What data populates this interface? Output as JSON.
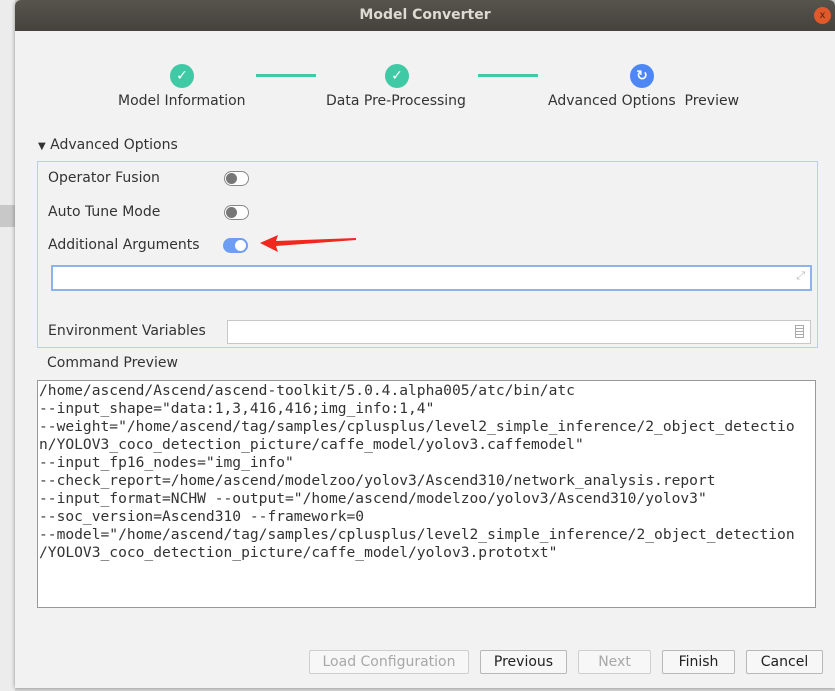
{
  "window": {
    "title": "Model Converter",
    "close_icon": "x"
  },
  "steps": [
    {
      "label": "Model Information",
      "state": "done",
      "icon": "✓"
    },
    {
      "label": "Data Pre-Processing",
      "state": "done",
      "icon": "✓"
    },
    {
      "label": "Advanced Options  Preview",
      "state": "current",
      "icon": "↻"
    }
  ],
  "colors": {
    "done": "#3fc9a4",
    "current": "#4d87f5",
    "arrow": "#f0281e"
  },
  "advanced": {
    "header": "Advanced Options",
    "arrow": "▼",
    "operator_fusion": {
      "label": "Operator Fusion",
      "on": false
    },
    "auto_tune": {
      "label": "Auto Tune Mode",
      "on": false
    },
    "additional_args": {
      "label": "Additional Arguments",
      "on": true,
      "value": ""
    },
    "env_vars": {
      "label": "Environment Variables",
      "value": ""
    }
  },
  "command_preview": {
    "label": "Command Preview",
    "lines": [
      "/home/ascend/Ascend/ascend-toolkit/5.0.4.alpha005/atc/bin/atc",
      "--input_shape=\"data:1,3,416,416;img_info:1,4\"",
      "--weight=\"/home/ascend/tag/samples/cplusplus/level2_simple_inference/2_object_detectio",
      "n/YOLOV3_coco_detection_picture/caffe_model/yolov3.caffemodel\"",
      "--input_fp16_nodes=\"img_info\"",
      "--check_report=/home/ascend/modelzoo/yolov3/Ascend310/network_analysis.report",
      "--input_format=NCHW --output=\"/home/ascend/modelzoo/yolov3/Ascend310/yolov3\"",
      "--soc_version=Ascend310 --framework=0",
      "--model=\"/home/ascend/tag/samples/cplusplus/level2_simple_inference/2_object_detection",
      "/YOLOV3_coco_detection_picture/caffe_model/yolov3.prototxt\""
    ]
  },
  "buttons": {
    "load": "Load Configuration",
    "previous": "Previous",
    "next": "Next",
    "finish": "Finish",
    "cancel": "Cancel"
  }
}
